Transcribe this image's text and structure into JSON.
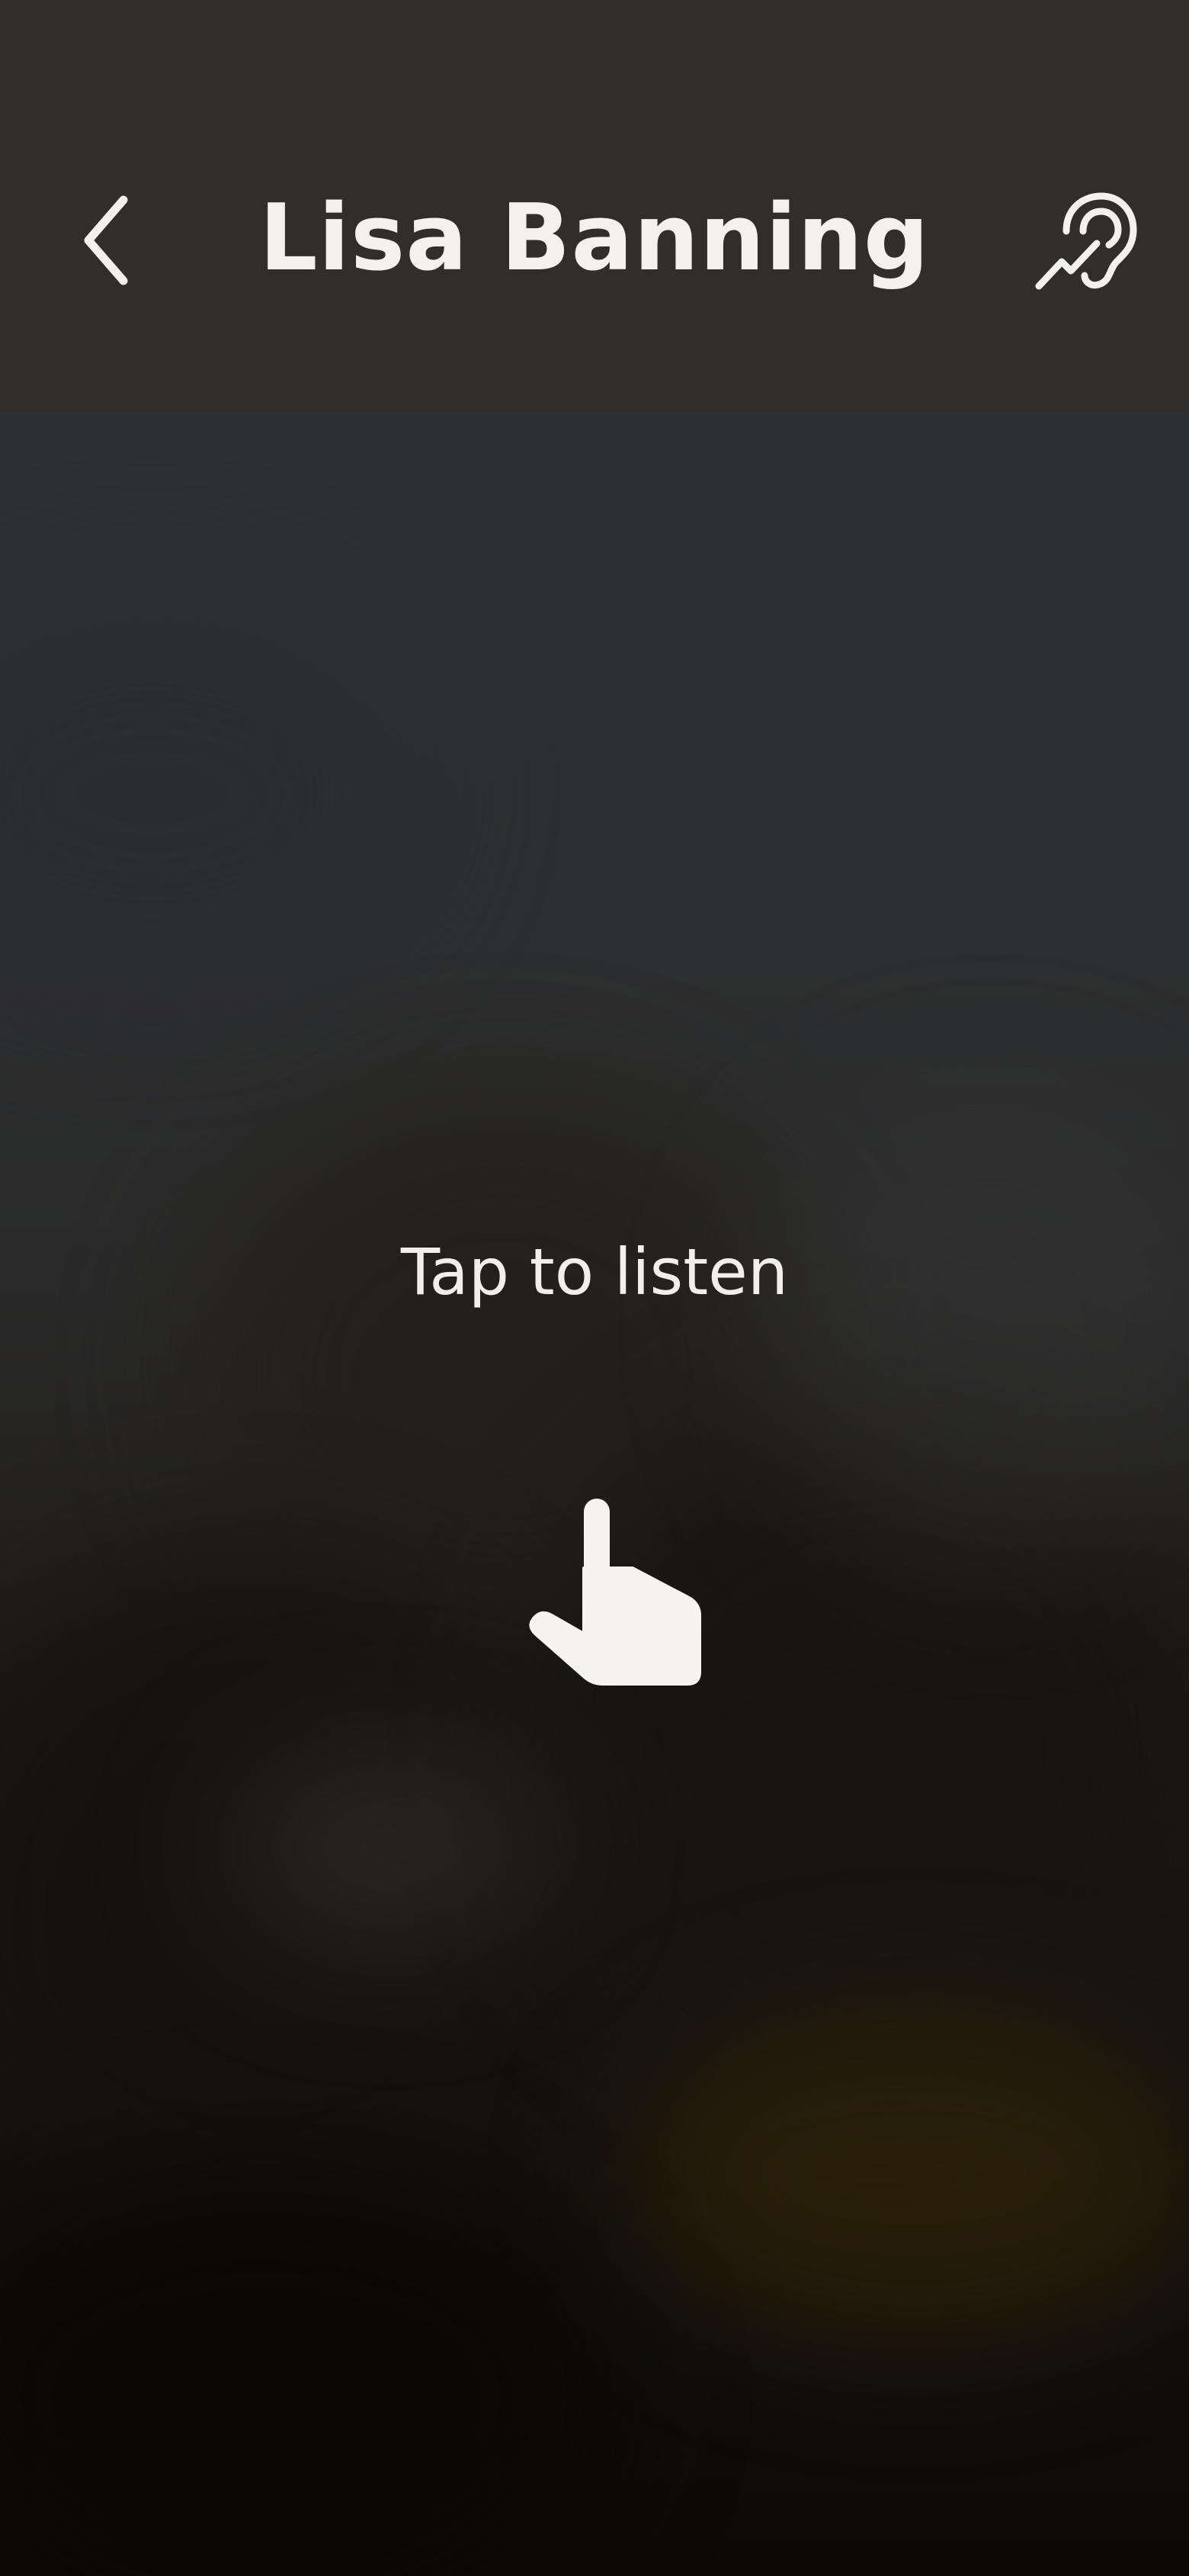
{
  "header": {
    "title": "Lisa Banning",
    "back_icon": "chevron-left-icon",
    "hearing_icon": "hearing-ear-icon"
  },
  "main": {
    "prompt": "Tap to listen",
    "gesture_icon": "tap-hand-icon"
  },
  "colors": {
    "header_background": "#302e2a",
    "text": "#f4f1ec",
    "scene_top": "#2d2f31",
    "scene_bottom": "#0c0907"
  }
}
